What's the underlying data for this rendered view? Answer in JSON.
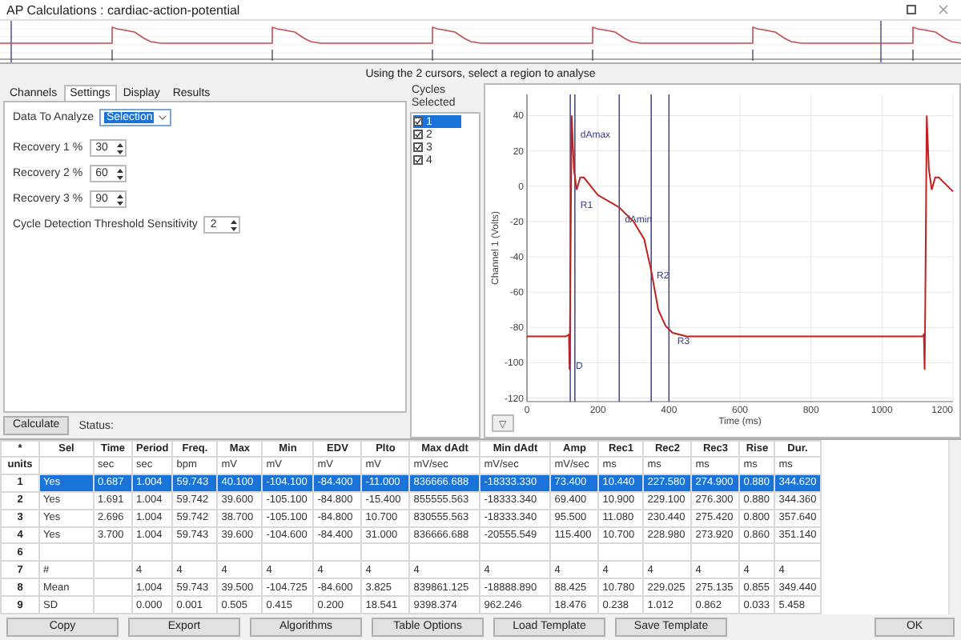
{
  "window": {
    "title": "AP Calculations : cardiac-action-potential"
  },
  "instruction": "Using the 2 cursors, select a region to analyse",
  "settings": {
    "tabs": [
      {
        "label": "Channels",
        "selected": false
      },
      {
        "label": "Settings",
        "selected": true
      },
      {
        "label": "Display",
        "selected": false
      },
      {
        "label": "Results",
        "selected": false
      }
    ],
    "data_to_analyze": {
      "label": "Data To Analyze",
      "value": "Selection"
    },
    "spinners": [
      {
        "label": "Recovery 1 %",
        "value": "30"
      },
      {
        "label": "Recovery 2 %",
        "value": "60"
      },
      {
        "label": "Recovery 3 %",
        "value": "90"
      },
      {
        "label": "Cycle Detection Threshold Sensitivity",
        "value": "2"
      }
    ],
    "calculate": "Calculate",
    "status_label": "Status:"
  },
  "cycles": {
    "title": "Cycles Selected",
    "items": [
      {
        "label": "1",
        "checked": true,
        "selected": true
      },
      {
        "label": "2",
        "checked": true,
        "selected": false
      },
      {
        "label": "3",
        "checked": true,
        "selected": false
      },
      {
        "label": "4",
        "checked": true,
        "selected": false
      }
    ]
  },
  "chart_data": {
    "type": "line",
    "xlabel": "Time (ms)",
    "ylabel": "Channel 1 (Volts)",
    "xlim": [
      0,
      1200
    ],
    "ylim": [
      -122,
      52
    ],
    "grid": true,
    "xticks": [
      0,
      200,
      400,
      600,
      800,
      1000,
      1200
    ],
    "yticks": [
      -120,
      -100,
      -80,
      -60,
      -40,
      -20,
      0,
      20,
      40
    ],
    "x": [
      0,
      110,
      118,
      120,
      122,
      126,
      132,
      140,
      150,
      160,
      200,
      260,
      300,
      330,
      350,
      370,
      390,
      410,
      450,
      500,
      1100,
      1114,
      1118,
      1120,
      1122,
      1126,
      1132,
      1140,
      1150,
      1160,
      1200
    ],
    "series": [
      {
        "color": "#c0201e",
        "values": [
          -85,
          -85,
          -84,
          -104,
          -66,
          40,
          10,
          -2,
          5,
          5,
          -5,
          -12,
          -20,
          -30,
          -48,
          -70,
          -79,
          -83,
          -85,
          -85,
          -85,
          -85,
          -84,
          -104,
          -66,
          40,
          10,
          -2,
          5,
          5,
          -3
        ]
      }
    ],
    "ref_lines": [
      {
        "axis": "x",
        "value": 122
      },
      {
        "axis": "x",
        "value": 135
      },
      {
        "axis": "x",
        "value": 260
      },
      {
        "axis": "x",
        "value": 350
      },
      {
        "axis": "x",
        "value": 400
      }
    ],
    "annotations": [
      {
        "x": 124,
        "y": -98,
        "text": "D"
      },
      {
        "x": 137,
        "y": 33,
        "text": "dAmax"
      },
      {
        "x": 137,
        "y": -7,
        "text": "R1"
      },
      {
        "x": 262,
        "y": -15,
        "text": "dAmin"
      },
      {
        "x": 352,
        "y": -47,
        "text": "R2"
      },
      {
        "x": 410,
        "y": -84,
        "text": "R3"
      }
    ]
  },
  "chart_menu": "▽",
  "table": {
    "corner": "*",
    "columns": [
      "Sel",
      "Time",
      "Period",
      "Freq.",
      "Max",
      "Min",
      "EDV",
      "Plto",
      "Max dAdt",
      "Min dAdt",
      "Amp",
      "Rec1",
      "Rec2",
      "Rec3",
      "Rise",
      "Dur."
    ],
    "rows": [
      {
        "label": "units",
        "selected": false,
        "cells": [
          null,
          "sec",
          "sec",
          "bpm",
          "mV",
          "mV",
          "mV",
          "mV",
          "mV/sec",
          "mV/sec",
          "mV/sec",
          "ms",
          "ms",
          "ms",
          "ms",
          "ms"
        ]
      },
      {
        "label": "1",
        "selected": true,
        "cells": [
          "Yes",
          "0.687",
          "1.004",
          "59.743",
          "40.100",
          "-104.100",
          "-84.400",
          "-11.000",
          "836666.688",
          "-18333.330",
          "73.400",
          "10.440",
          "227.580",
          "274.900",
          "0.880",
          "344.620"
        ]
      },
      {
        "label": "2",
        "selected": false,
        "cells": [
          "Yes",
          "1.691",
          "1.004",
          "59.742",
          "39.600",
          "-105.100",
          "-84.800",
          "-15.400",
          "855555.563",
          "-18333.340",
          "69.400",
          "10.900",
          "229.100",
          "276.300",
          "0.880",
          "344.360"
        ]
      },
      {
        "label": "3",
        "selected": false,
        "cells": [
          "Yes",
          "2.696",
          "1.004",
          "59.742",
          "38.700",
          "-105.100",
          "-84.800",
          "10.700",
          "830555.563",
          "-18333.340",
          "95.500",
          "11.080",
          "230.440",
          "275.420",
          "0.800",
          "357.640"
        ]
      },
      {
        "label": "4",
        "selected": false,
        "cells": [
          "Yes",
          "3.700",
          "1.004",
          "59.743",
          "39.600",
          "-104.600",
          "-84.400",
          "31.000",
          "836666.688",
          "-20555.549",
          "115.400",
          "10.700",
          "228.980",
          "273.920",
          "0.860",
          "351.140"
        ]
      },
      {
        "label": "6",
        "selected": false,
        "cells": [
          null,
          null,
          null,
          null,
          null,
          null,
          null,
          null,
          null,
          null,
          null,
          null,
          null,
          null,
          null,
          null
        ]
      },
      {
        "label": "7",
        "selected": false,
        "cells": [
          "#",
          null,
          "4",
          "4",
          "4",
          "4",
          "4",
          "4",
          "4",
          "4",
          "4",
          "4",
          "4",
          "4",
          "4",
          "4"
        ]
      },
      {
        "label": "8",
        "selected": false,
        "cells": [
          "Mean",
          null,
          "1.004",
          "59.743",
          "39.500",
          "-104.725",
          "-84.600",
          "3.825",
          "839861.125",
          "-18888.890",
          "88.425",
          "10.780",
          "229.025",
          "275.135",
          "0.855",
          "349.440"
        ]
      },
      {
        "label": "9",
        "selected": false,
        "cells": [
          "SD",
          null,
          "0.000",
          "0.001",
          "0.505",
          "0.415",
          "0.200",
          "18.541",
          "9398.374",
          "962.246",
          "18.476",
          "0.238",
          "1.012",
          "0.862",
          "0.033",
          "5.458"
        ]
      }
    ]
  },
  "buttons": [
    "Copy",
    "Export",
    "Algorithms",
    "Table Options",
    "Load Template",
    "Save Template"
  ],
  "ok": "OK"
}
